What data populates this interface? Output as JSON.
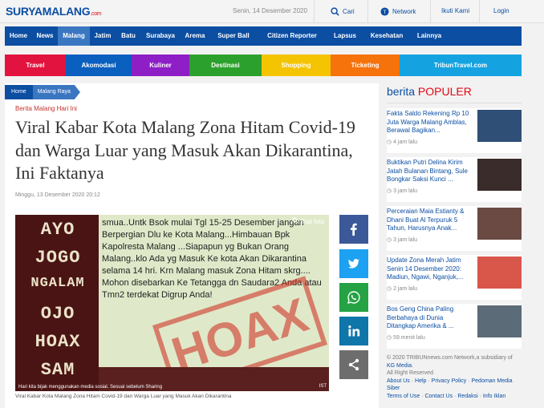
{
  "header": {
    "logo_text": "SURYAMALANG",
    "logo_suffix": ".com",
    "date": "Senin, 14 Desember 2020",
    "search_label": "Cari",
    "network_label": "Network",
    "follow_label": "Ikuti Kami",
    "login_label": "Login"
  },
  "nav": [
    "Home",
    "News",
    "Malang",
    "Jatim",
    "Batu",
    "Surabaya",
    "Arema",
    "Super Ball",
    "Citizen Reporter",
    "Lapsus",
    "Kesehatan",
    "Lainnya"
  ],
  "nav_active": "Malang",
  "nav2": [
    {
      "label": "Travel",
      "color": "#e2133e"
    },
    {
      "label": "Akomodasi",
      "color": "#0a5fbf"
    },
    {
      "label": "Kuliner",
      "color": "#8e1ec6"
    },
    {
      "label": "Destinasi",
      "color": "#2ca02c"
    },
    {
      "label": "Shopping",
      "color": "#f5c400"
    },
    {
      "label": "Ticketing",
      "color": "#f6720b"
    },
    {
      "label": "TribunTravel.com",
      "color": "#14a3e0"
    }
  ],
  "breadcrumb": [
    "Home",
    "Malang Raya"
  ],
  "article": {
    "kanal": "Berita Malang Hari Ini",
    "title": "Viral Kabar Kota Malang Zona Hitam Covid-19 dan Warga Luar yang Masuk Akan Dikarantina, Ini Faktanya",
    "date": "Minggu, 13 Desember 2020 20:12",
    "photo_left_text": [
      "AYO",
      "JOGO",
      "NGALAM",
      "OJO",
      "HOAX",
      "SAM"
    ],
    "photo_note": "smua..Untk Bsok mulai Tgl 15-25 Desember jangan Berpergian Dlu ke Kota Malang...Himbauan Bpk Kapolresta Malang ...Siapapun yg Bukan Orang Malang..klo Ada yg Masuk Ke kota Akan Dikarantina selama 14 hri. Krn Malang masuk Zona Hitam skrg.... Mohon disebarkan Ke Tetangga dn Saudara2 Anda atau Tmn2 terdekat Digrup Anda!",
    "hoax_stamp": "HOAX",
    "lihat_foto": "lihat foto",
    "photo_bottom": "Hari kita bijak menggunakan media sosial. Sesuai sebelum Sharing",
    "ist": "IST",
    "caption": "Viral Kabar Kota Malang Zona Hitam Covid-19 dan Warga Luar yang Masuk Akan Dikarantina"
  },
  "share": [
    {
      "name": "facebook",
      "color": "#3b5998",
      "icon": "facebook-icon"
    },
    {
      "name": "twitter",
      "color": "#1da1f2",
      "icon": "twitter-icon"
    },
    {
      "name": "whatsapp",
      "color": "#25a244",
      "icon": "whatsapp-icon"
    },
    {
      "name": "linkedin",
      "color": "#0e76a8",
      "icon": "linkedin-icon"
    },
    {
      "name": "share",
      "color": "#6d6d6d",
      "icon": "share-icon"
    }
  ],
  "sidebar": {
    "title_prefix": "berita",
    "title_highlight": "POPULER",
    "items": [
      {
        "title": "Fakta Saldo Rekening Rp 10 Juta Warga Malang Amblas, Berawal Bagikan...",
        "time": "4 jam lalu",
        "thumb": "#2f4f77"
      },
      {
        "title": "Buktikan Putri Delina Kirim Jatah Bulanan Bintang, Sule Bongkar Saksi Kunci ...",
        "time": "3 jam lalu",
        "thumb": "#3a2c2a"
      },
      {
        "title": "Perceraian Maia Estianty & Dhani Buat Al Terpuruk 5 Tahun, Harusnya Anak...",
        "time": "3 jam lalu",
        "thumb": "#6b4a44"
      },
      {
        "title": "Update Zona Merah Jatim Senin 14 Desember 2020: Madiun, Ngawi, Nganjuk,...",
        "time": "2 jam lalu",
        "thumb": "#d9564a"
      },
      {
        "title": "Bos Geng China Paling Berbahaya di Dunia Ditangkap Amerika & ...",
        "time": "59 menit lalu",
        "thumb": "#5c6b78"
      }
    ]
  },
  "footer": {
    "copyright": "© 2020 TRIBUNnews.com Network,a subsidiary of",
    "kg": "KG Media",
    "rights": "All Right Reserved",
    "links1": [
      "About Us",
      "Help",
      "Privacy Policy",
      "Pedoman Media Siber"
    ],
    "links2": [
      "Terms of Use",
      "Contact Us",
      "Redaksi",
      "Info Iklan"
    ]
  }
}
